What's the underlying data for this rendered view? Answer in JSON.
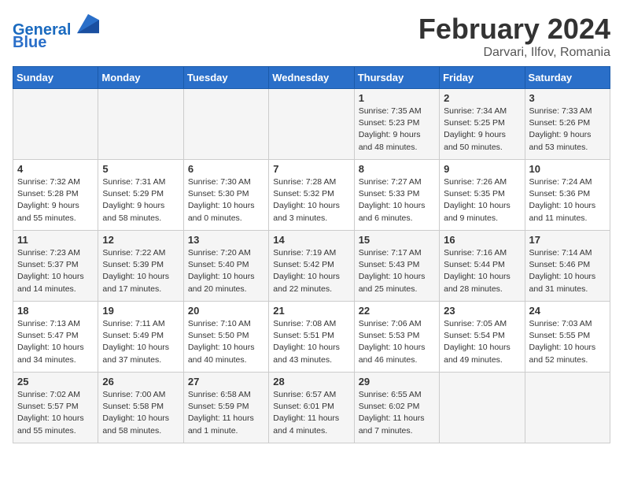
{
  "header": {
    "logo_line1": "General",
    "logo_line2": "Blue",
    "title": "February 2024",
    "subtitle": "Darvari, Ilfov, Romania"
  },
  "weekdays": [
    "Sunday",
    "Monday",
    "Tuesday",
    "Wednesday",
    "Thursday",
    "Friday",
    "Saturday"
  ],
  "weeks": [
    [
      {
        "day": "",
        "info": ""
      },
      {
        "day": "",
        "info": ""
      },
      {
        "day": "",
        "info": ""
      },
      {
        "day": "",
        "info": ""
      },
      {
        "day": "1",
        "info": "Sunrise: 7:35 AM\nSunset: 5:23 PM\nDaylight: 9 hours\nand 48 minutes."
      },
      {
        "day": "2",
        "info": "Sunrise: 7:34 AM\nSunset: 5:25 PM\nDaylight: 9 hours\nand 50 minutes."
      },
      {
        "day": "3",
        "info": "Sunrise: 7:33 AM\nSunset: 5:26 PM\nDaylight: 9 hours\nand 53 minutes."
      }
    ],
    [
      {
        "day": "4",
        "info": "Sunrise: 7:32 AM\nSunset: 5:28 PM\nDaylight: 9 hours\nand 55 minutes."
      },
      {
        "day": "5",
        "info": "Sunrise: 7:31 AM\nSunset: 5:29 PM\nDaylight: 9 hours\nand 58 minutes."
      },
      {
        "day": "6",
        "info": "Sunrise: 7:30 AM\nSunset: 5:30 PM\nDaylight: 10 hours\nand 0 minutes."
      },
      {
        "day": "7",
        "info": "Sunrise: 7:28 AM\nSunset: 5:32 PM\nDaylight: 10 hours\nand 3 minutes."
      },
      {
        "day": "8",
        "info": "Sunrise: 7:27 AM\nSunset: 5:33 PM\nDaylight: 10 hours\nand 6 minutes."
      },
      {
        "day": "9",
        "info": "Sunrise: 7:26 AM\nSunset: 5:35 PM\nDaylight: 10 hours\nand 9 minutes."
      },
      {
        "day": "10",
        "info": "Sunrise: 7:24 AM\nSunset: 5:36 PM\nDaylight: 10 hours\nand 11 minutes."
      }
    ],
    [
      {
        "day": "11",
        "info": "Sunrise: 7:23 AM\nSunset: 5:37 PM\nDaylight: 10 hours\nand 14 minutes."
      },
      {
        "day": "12",
        "info": "Sunrise: 7:22 AM\nSunset: 5:39 PM\nDaylight: 10 hours\nand 17 minutes."
      },
      {
        "day": "13",
        "info": "Sunrise: 7:20 AM\nSunset: 5:40 PM\nDaylight: 10 hours\nand 20 minutes."
      },
      {
        "day": "14",
        "info": "Sunrise: 7:19 AM\nSunset: 5:42 PM\nDaylight: 10 hours\nand 22 minutes."
      },
      {
        "day": "15",
        "info": "Sunrise: 7:17 AM\nSunset: 5:43 PM\nDaylight: 10 hours\nand 25 minutes."
      },
      {
        "day": "16",
        "info": "Sunrise: 7:16 AM\nSunset: 5:44 PM\nDaylight: 10 hours\nand 28 minutes."
      },
      {
        "day": "17",
        "info": "Sunrise: 7:14 AM\nSunset: 5:46 PM\nDaylight: 10 hours\nand 31 minutes."
      }
    ],
    [
      {
        "day": "18",
        "info": "Sunrise: 7:13 AM\nSunset: 5:47 PM\nDaylight: 10 hours\nand 34 minutes."
      },
      {
        "day": "19",
        "info": "Sunrise: 7:11 AM\nSunset: 5:49 PM\nDaylight: 10 hours\nand 37 minutes."
      },
      {
        "day": "20",
        "info": "Sunrise: 7:10 AM\nSunset: 5:50 PM\nDaylight: 10 hours\nand 40 minutes."
      },
      {
        "day": "21",
        "info": "Sunrise: 7:08 AM\nSunset: 5:51 PM\nDaylight: 10 hours\nand 43 minutes."
      },
      {
        "day": "22",
        "info": "Sunrise: 7:06 AM\nSunset: 5:53 PM\nDaylight: 10 hours\nand 46 minutes."
      },
      {
        "day": "23",
        "info": "Sunrise: 7:05 AM\nSunset: 5:54 PM\nDaylight: 10 hours\nand 49 minutes."
      },
      {
        "day": "24",
        "info": "Sunrise: 7:03 AM\nSunset: 5:55 PM\nDaylight: 10 hours\nand 52 minutes."
      }
    ],
    [
      {
        "day": "25",
        "info": "Sunrise: 7:02 AM\nSunset: 5:57 PM\nDaylight: 10 hours\nand 55 minutes."
      },
      {
        "day": "26",
        "info": "Sunrise: 7:00 AM\nSunset: 5:58 PM\nDaylight: 10 hours\nand 58 minutes."
      },
      {
        "day": "27",
        "info": "Sunrise: 6:58 AM\nSunset: 5:59 PM\nDaylight: 11 hours\nand 1 minute."
      },
      {
        "day": "28",
        "info": "Sunrise: 6:57 AM\nSunset: 6:01 PM\nDaylight: 11 hours\nand 4 minutes."
      },
      {
        "day": "29",
        "info": "Sunrise: 6:55 AM\nSunset: 6:02 PM\nDaylight: 11 hours\nand 7 minutes."
      },
      {
        "day": "",
        "info": ""
      },
      {
        "day": "",
        "info": ""
      }
    ]
  ]
}
